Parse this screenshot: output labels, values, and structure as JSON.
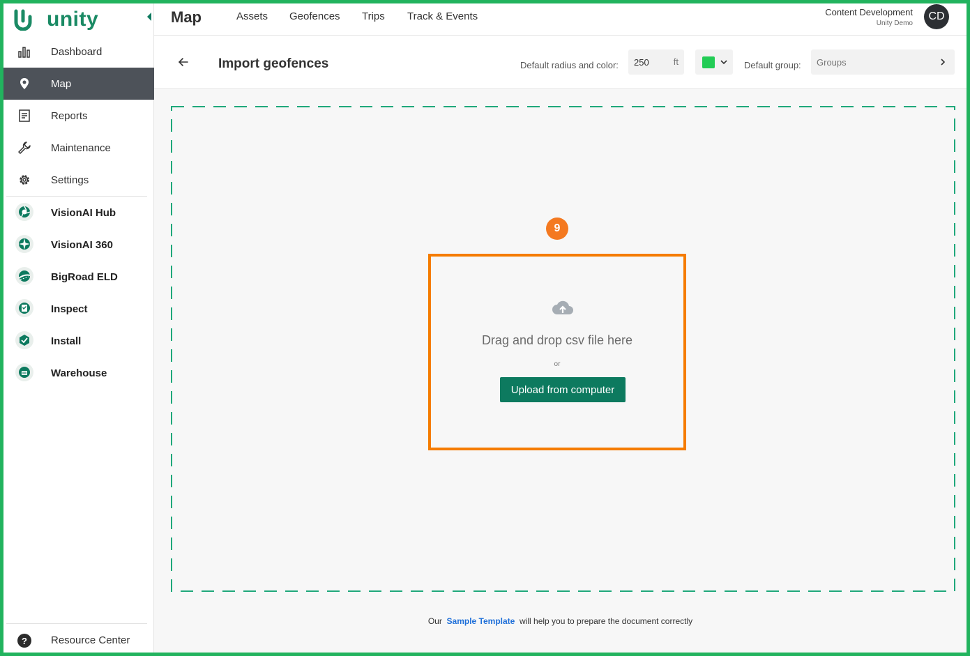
{
  "app": {
    "brand": "unity",
    "accent": "#1a8a64",
    "frame_color": "#22b35e"
  },
  "sidebar": {
    "items": [
      {
        "label": "Dashboard",
        "icon": "bar-chart-icon"
      },
      {
        "label": "Map",
        "icon": "map-pin-icon",
        "active": true
      },
      {
        "label": "Reports",
        "icon": "report-icon"
      },
      {
        "label": "Maintenance",
        "icon": "wrench-icon"
      },
      {
        "label": "Settings",
        "icon": "gear-icon"
      }
    ],
    "apps": [
      {
        "label": "VisionAI Hub",
        "icon": "visionai-hub-icon"
      },
      {
        "label": "VisionAI 360",
        "icon": "visionai-360-icon"
      },
      {
        "label": "BigRoad ELD",
        "icon": "bigroad-eld-icon"
      },
      {
        "label": "Inspect",
        "icon": "inspect-icon"
      },
      {
        "label": "Install",
        "icon": "install-icon"
      },
      {
        "label": "Warehouse",
        "icon": "warehouse-icon"
      }
    ],
    "resource_center": "Resource Center"
  },
  "topbar": {
    "title": "Map",
    "tabs": [
      "Assets",
      "Geofences",
      "Trips",
      "Track & Events"
    ],
    "user_name": "Content Development",
    "user_org": "Unity Demo",
    "avatar_initials": "CD"
  },
  "import": {
    "title": "Import geofences",
    "radius_label": "Default radius and color:",
    "radius_value": "250",
    "radius_unit": "ft",
    "color": "#22cc55",
    "group_label": "Default group:",
    "group_placeholder": "Groups"
  },
  "dropzone": {
    "step": "9",
    "drop_text": "Drag and drop csv file here",
    "or_text": "or",
    "upload_label": "Upload from computer",
    "highlight_color": "#f57c00"
  },
  "footer": {
    "prefix": "Our",
    "link": "Sample Template",
    "suffix": "will help you to prepare the document correctly"
  }
}
